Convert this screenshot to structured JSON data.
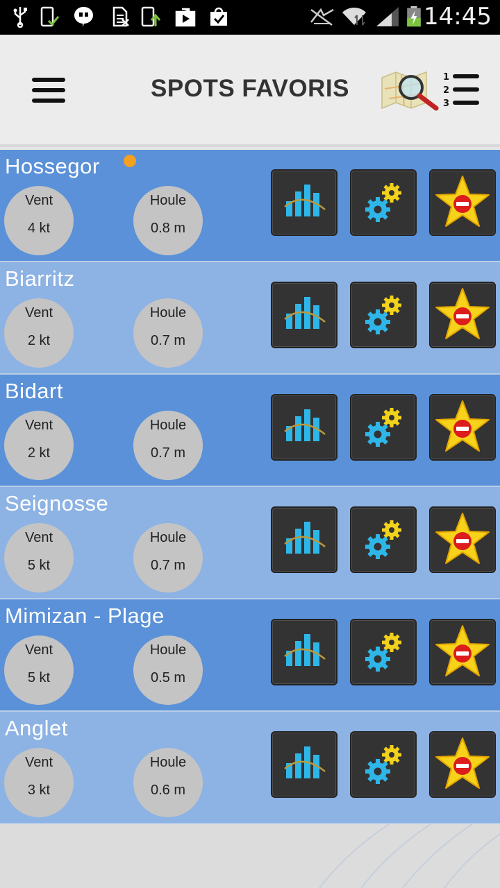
{
  "status_bar": {
    "time": "14:45",
    "icons": [
      "usb-icon",
      "phone-check-icon",
      "hangouts-icon",
      "sim-card-icon",
      "phone-upload-icon",
      "play-store-icon",
      "shopping-bag-icon",
      "nfc-muted-icon",
      "wifi-icon",
      "signal-icon",
      "battery-charging-icon"
    ]
  },
  "header": {
    "title": "SPOTS FAVORIS",
    "left_icon": "menu-icon",
    "right_icons": [
      "map-search-icon",
      "ranked-list-icon"
    ],
    "ranked_numbers": [
      "1",
      "2",
      "3"
    ]
  },
  "spots": [
    {
      "name": "Hossegor",
      "vent_label": "Vent",
      "vent": "4 kt",
      "houle_label": "Houle",
      "houle": "0.8 m",
      "new": true
    },
    {
      "name": "Biarritz",
      "vent_label": "Vent",
      "vent": "2 kt",
      "houle_label": "Houle",
      "houle": "0.7 m",
      "new": false
    },
    {
      "name": "Bidart",
      "vent_label": "Vent",
      "vent": "2 kt",
      "houle_label": "Houle",
      "houle": "0.7 m",
      "new": false
    },
    {
      "name": "Seignosse",
      "vent_label": "Vent",
      "vent": "5 kt",
      "houle_label": "Houle",
      "houle": "0.7 m",
      "new": false
    },
    {
      "name": "Mimizan - Plage",
      "vent_label": "Vent",
      "vent": "5 kt",
      "houle_label": "Houle",
      "houle": "0.5 m",
      "new": false
    },
    {
      "name": "Anglet",
      "vent_label": "Vent",
      "vent": "3 kt",
      "houle_label": "Houle",
      "houle": "0.6 m",
      "new": false
    }
  ],
  "action_icons": [
    "forecast-chart-icon",
    "spot-settings-icon",
    "remove-favorite-star-icon"
  ],
  "colors": {
    "row_dark": "#5a91d8",
    "row_light": "#8db2e4",
    "new_indicator": "#f5a020",
    "button_bg": "#333333",
    "gauge_bg": "#c4c4c4"
  }
}
